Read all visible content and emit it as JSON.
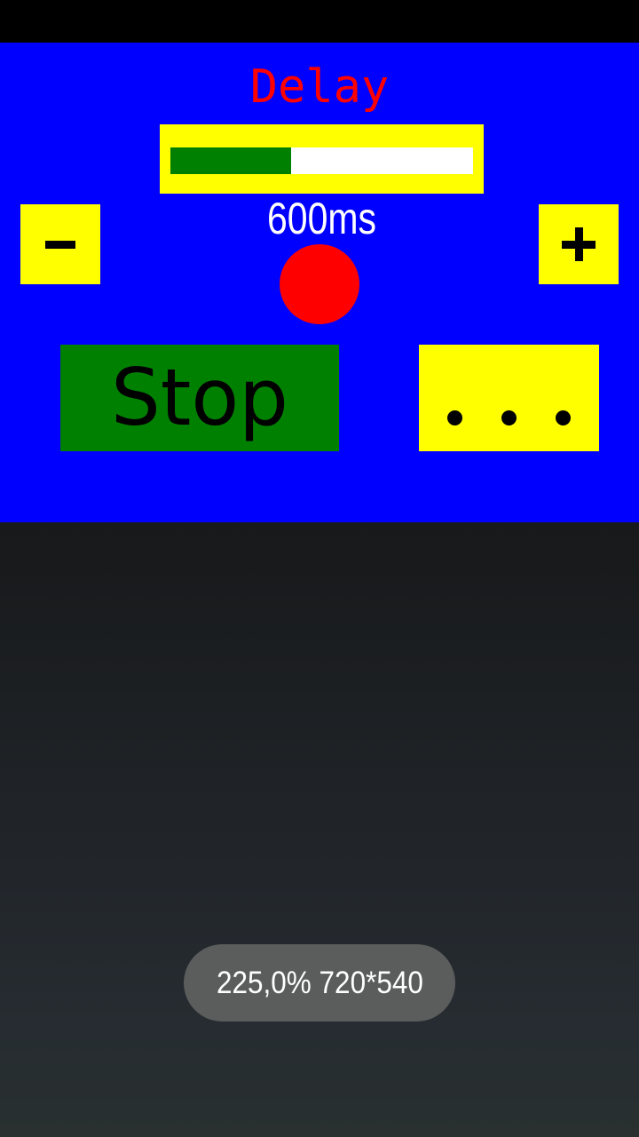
{
  "app": {
    "title": "Delay",
    "title_color": "#ff0000",
    "surface_color": "#0000ff"
  },
  "status_strip": {
    "color": "#000000"
  },
  "progress": {
    "percent": 40,
    "frame_color": "#ffff00",
    "track_color": "#ffffff",
    "fill_color": "#008000"
  },
  "delay": {
    "value_label": "600ms",
    "value": 600,
    "unit": "ms",
    "value_color": "#ffffff"
  },
  "controls": {
    "decrease_label": "−",
    "decrease_icon": "minus-icon",
    "increase_label": "+",
    "increase_icon": "plus-icon",
    "button_color": "#ffff00"
  },
  "indicator": {
    "state": "active",
    "color": "#ff0000",
    "icon": "circle-indicator-icon"
  },
  "actions": {
    "stop_label": "Stop",
    "stop_color": "#008000",
    "stop_text_color": "#000000",
    "more_icon": "ellipsis-icon",
    "more_label": "• • •",
    "more_color": "#ffff00",
    "more_dots": [
      1,
      2,
      3
    ]
  },
  "toast": {
    "scale_label": "225,0% 720*540",
    "scale_percent": "225,0%",
    "resolution": "720*540",
    "background": "#5b5c5c",
    "text_color": "#ffffff"
  }
}
